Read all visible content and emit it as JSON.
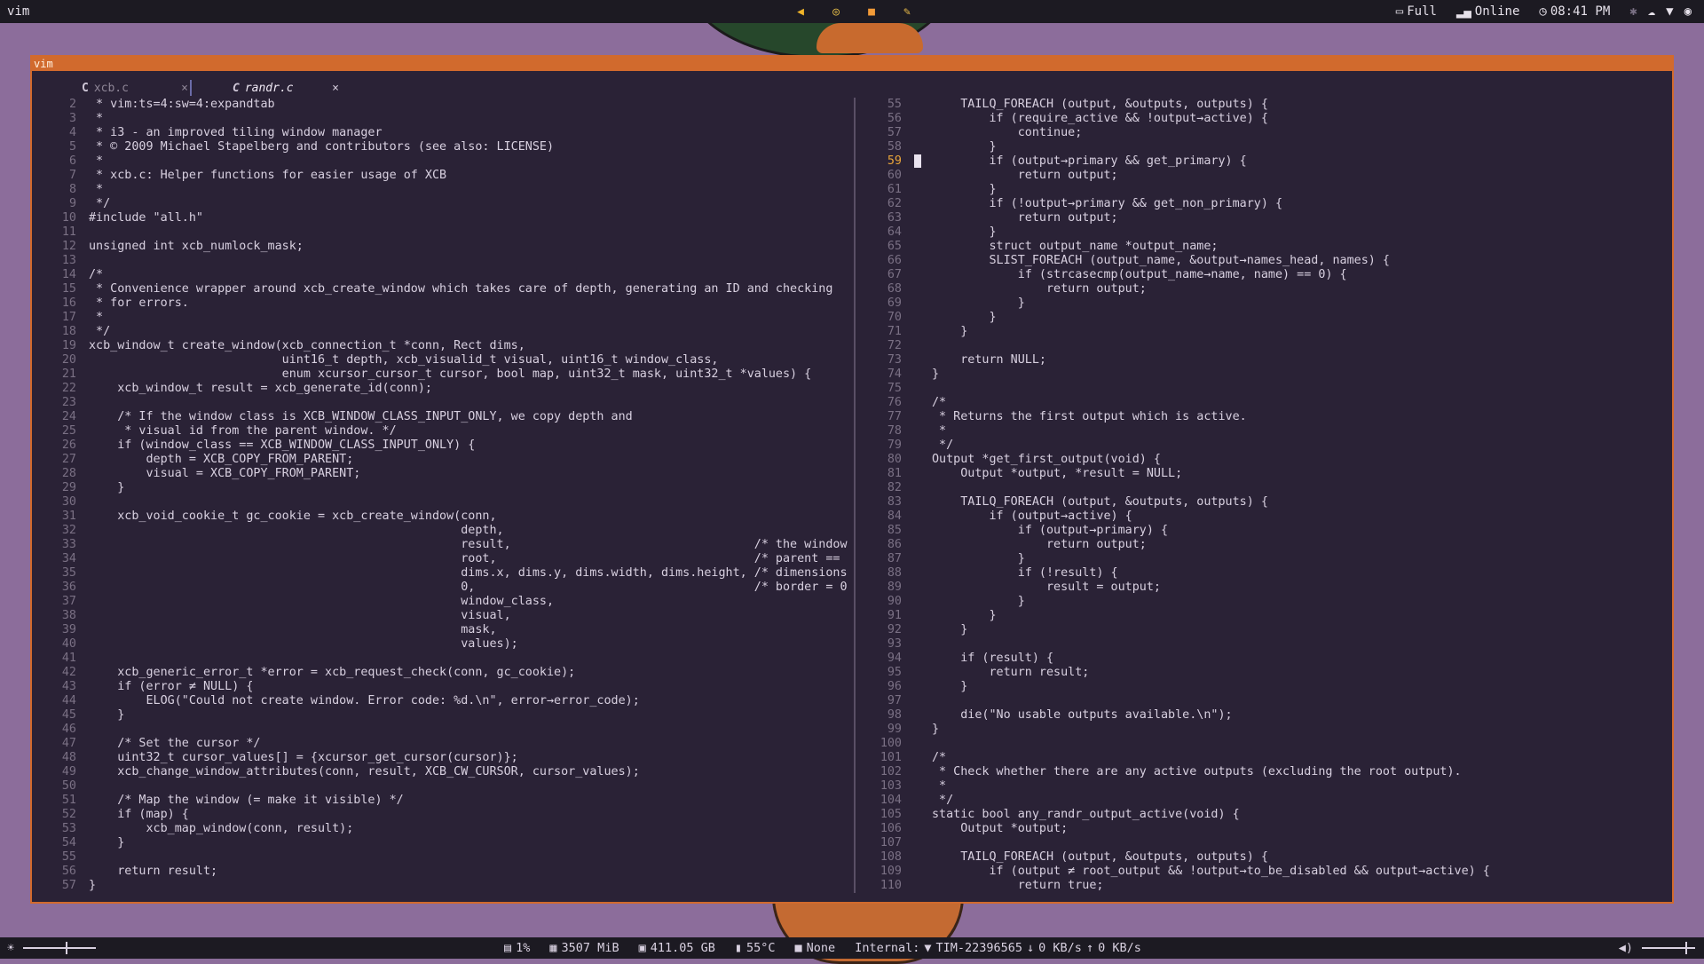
{
  "topbar": {
    "workspace": "vim",
    "battery": "Full",
    "network": "Online",
    "time": "08:41 PM"
  },
  "window": {
    "title": "vim",
    "tabs": [
      {
        "icon": "C",
        "name": "xcb.c",
        "close": "×"
      },
      {
        "icon": "C",
        "name": "randr.c",
        "close": "×"
      }
    ]
  },
  "colors": {
    "accent": "#d16a2d",
    "background": "#2a2236",
    "wallpaper": "#8c6d9b"
  },
  "left_pane": {
    "current_line": null,
    "lines": [
      {
        "n": "2",
        "t": " * vim:ts=4:sw=4:expandtab"
      },
      {
        "n": "3",
        "t": " *"
      },
      {
        "n": "4",
        "t": " * i3 - an improved tiling window manager"
      },
      {
        "n": "5",
        "t": " * © 2009 Michael Stapelberg and contributors (see also: LICENSE)"
      },
      {
        "n": "6",
        "t": " *"
      },
      {
        "n": "7",
        "t": " * xcb.c: Helper functions for easier usage of XCB"
      },
      {
        "n": "8",
        "t": " *"
      },
      {
        "n": "9",
        "t": " */"
      },
      {
        "n": "10",
        "t": "#include \"all.h\""
      },
      {
        "n": "11",
        "t": ""
      },
      {
        "n": "12",
        "t": "unsigned int xcb_numlock_mask;"
      },
      {
        "n": "13",
        "t": ""
      },
      {
        "n": "14",
        "t": "/*"
      },
      {
        "n": "15",
        "t": " * Convenience wrapper around xcb_create_window which takes care of depth, generating an ID and checking"
      },
      {
        "n": "16",
        "t": " * for errors."
      },
      {
        "n": "17",
        "t": " *"
      },
      {
        "n": "18",
        "t": " */"
      },
      {
        "n": "19",
        "t": "xcb_window_t create_window(xcb_connection_t *conn, Rect dims,"
      },
      {
        "n": "20",
        "t": "                           uint16_t depth, xcb_visualid_t visual, uint16_t window_class,"
      },
      {
        "n": "21",
        "t": "                           enum xcursor_cursor_t cursor, bool map, uint32_t mask, uint32_t *values) {"
      },
      {
        "n": "22",
        "t": "    xcb_window_t result = xcb_generate_id(conn);"
      },
      {
        "n": "23",
        "t": ""
      },
      {
        "n": "24",
        "t": "    /* If the window class is XCB_WINDOW_CLASS_INPUT_ONLY, we copy depth and"
      },
      {
        "n": "25",
        "t": "     * visual id from the parent window. */"
      },
      {
        "n": "26",
        "t": "    if (window_class == XCB_WINDOW_CLASS_INPUT_ONLY) {"
      },
      {
        "n": "27",
        "t": "        depth = XCB_COPY_FROM_PARENT;"
      },
      {
        "n": "28",
        "t": "        visual = XCB_COPY_FROM_PARENT;"
      },
      {
        "n": "29",
        "t": "    }"
      },
      {
        "n": "30",
        "t": ""
      },
      {
        "n": "31",
        "t": "    xcb_void_cookie_t gc_cookie = xcb_create_window(conn,"
      },
      {
        "n": "32",
        "t": "                                                    depth,"
      },
      {
        "n": "33",
        "t": "                                                    result,                                  /* the window"
      },
      {
        "n": "34",
        "t": "                                                    root,                                    /* parent =="
      },
      {
        "n": "35",
        "t": "                                                    dims.x, dims.y, dims.width, dims.height, /* dimensions"
      },
      {
        "n": "36",
        "t": "                                                    0,                                       /* border = 0"
      },
      {
        "n": "37",
        "t": "                                                    window_class,"
      },
      {
        "n": "38",
        "t": "                                                    visual,"
      },
      {
        "n": "39",
        "t": "                                                    mask,"
      },
      {
        "n": "40",
        "t": "                                                    values);"
      },
      {
        "n": "41",
        "t": ""
      },
      {
        "n": "42",
        "t": "    xcb_generic_error_t *error = xcb_request_check(conn, gc_cookie);"
      },
      {
        "n": "43",
        "t": "    if (error ≠ NULL) {"
      },
      {
        "n": "44",
        "t": "        ELOG(\"Could not create window. Error code: %d.\\n\", error→error_code);"
      },
      {
        "n": "45",
        "t": "    }"
      },
      {
        "n": "46",
        "t": ""
      },
      {
        "n": "47",
        "t": "    /* Set the cursor */"
      },
      {
        "n": "48",
        "t": "    uint32_t cursor_values[] = {xcursor_get_cursor(cursor)};"
      },
      {
        "n": "49",
        "t": "    xcb_change_window_attributes(conn, result, XCB_CW_CURSOR, cursor_values);"
      },
      {
        "n": "50",
        "t": ""
      },
      {
        "n": "51",
        "t": "    /* Map the window (= make it visible) */"
      },
      {
        "n": "52",
        "t": "    if (map) {"
      },
      {
        "n": "53",
        "t": "        xcb_map_window(conn, result);"
      },
      {
        "n": "54",
        "t": "    }"
      },
      {
        "n": "55",
        "t": ""
      },
      {
        "n": "56",
        "t": "    return result;"
      },
      {
        "n": "57",
        "t": "}"
      }
    ]
  },
  "right_pane": {
    "current_line": "59",
    "lines": [
      {
        "n": "55",
        "t": "    TAILQ_FOREACH (output, &outputs, outputs) {"
      },
      {
        "n": "56",
        "t": "        if (require_active && !output→active) {"
      },
      {
        "n": "57",
        "t": "            continue;"
      },
      {
        "n": "58",
        "t": "        }"
      },
      {
        "n": "59",
        "t": "        if (output→primary && get_primary) {"
      },
      {
        "n": "60",
        "t": "            return output;"
      },
      {
        "n": "61",
        "t": "        }"
      },
      {
        "n": "62",
        "t": "        if (!output→primary && get_non_primary) {"
      },
      {
        "n": "63",
        "t": "            return output;"
      },
      {
        "n": "64",
        "t": "        }"
      },
      {
        "n": "65",
        "t": "        struct output_name *output_name;"
      },
      {
        "n": "66",
        "t": "        SLIST_FOREACH (output_name, &output→names_head, names) {"
      },
      {
        "n": "67",
        "t": "            if (strcasecmp(output_name→name, name) == 0) {"
      },
      {
        "n": "68",
        "t": "                return output;"
      },
      {
        "n": "69",
        "t": "            }"
      },
      {
        "n": "70",
        "t": "        }"
      },
      {
        "n": "71",
        "t": "    }"
      },
      {
        "n": "72",
        "t": ""
      },
      {
        "n": "73",
        "t": "    return NULL;"
      },
      {
        "n": "74",
        "t": "}"
      },
      {
        "n": "75",
        "t": ""
      },
      {
        "n": "76",
        "t": "/*"
      },
      {
        "n": "77",
        "t": " * Returns the first output which is active."
      },
      {
        "n": "78",
        "t": " *"
      },
      {
        "n": "79",
        "t": " */"
      },
      {
        "n": "80",
        "t": "Output *get_first_output(void) {"
      },
      {
        "n": "81",
        "t": "    Output *output, *result = NULL;"
      },
      {
        "n": "82",
        "t": ""
      },
      {
        "n": "83",
        "t": "    TAILQ_FOREACH (output, &outputs, outputs) {"
      },
      {
        "n": "84",
        "t": "        if (output→active) {"
      },
      {
        "n": "85",
        "t": "            if (output→primary) {"
      },
      {
        "n": "86",
        "t": "                return output;"
      },
      {
        "n": "87",
        "t": "            }"
      },
      {
        "n": "88",
        "t": "            if (!result) {"
      },
      {
        "n": "89",
        "t": "                result = output;"
      },
      {
        "n": "90",
        "t": "            }"
      },
      {
        "n": "91",
        "t": "        }"
      },
      {
        "n": "92",
        "t": "    }"
      },
      {
        "n": "93",
        "t": ""
      },
      {
        "n": "94",
        "t": "    if (result) {"
      },
      {
        "n": "95",
        "t": "        return result;"
      },
      {
        "n": "96",
        "t": "    }"
      },
      {
        "n": "97",
        "t": ""
      },
      {
        "n": "98",
        "t": "    die(\"No usable outputs available.\\n\");"
      },
      {
        "n": "99",
        "t": "}"
      },
      {
        "n": "100",
        "t": ""
      },
      {
        "n": "101",
        "t": "/*"
      },
      {
        "n": "102",
        "t": " * Check whether there are any active outputs (excluding the root output)."
      },
      {
        "n": "103",
        "t": " *"
      },
      {
        "n": "104",
        "t": " */"
      },
      {
        "n": "105",
        "t": "static bool any_randr_output_active(void) {"
      },
      {
        "n": "106",
        "t": "    Output *output;"
      },
      {
        "n": "107",
        "t": ""
      },
      {
        "n": "108",
        "t": "    TAILQ_FOREACH (output, &outputs, outputs) {"
      },
      {
        "n": "109",
        "t": "        if (output ≠ root_output && !output→to_be_disabled && output→active) {"
      },
      {
        "n": "110",
        "t": "            return true;"
      }
    ]
  },
  "statusbar": {
    "brightness_level": 0.6,
    "cpu": "1%",
    "memory": "3507 MiB",
    "disk": "411.05 GB",
    "temperature": "55°C",
    "media": "None",
    "net_label": "Internal:",
    "wifi_name": "TIM-22396565",
    "download": "0 KB/s",
    "upload": "0 KB/s",
    "volume_level": 0.85
  }
}
